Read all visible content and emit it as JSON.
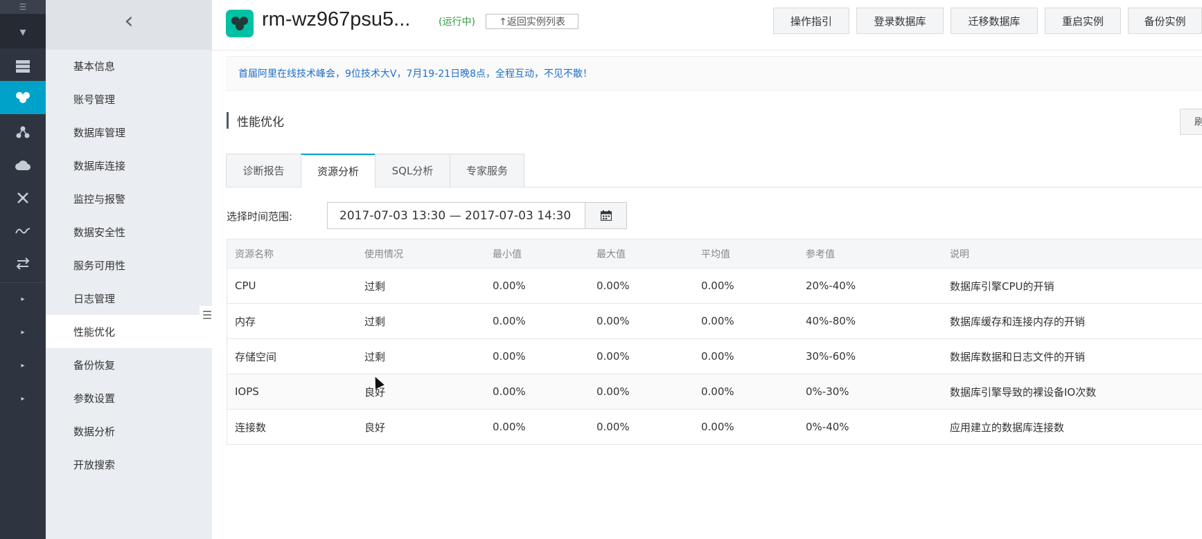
{
  "rail": {
    "icons": [
      "menu-icon",
      "caret-down-icon",
      "server-icon",
      "rds-icon",
      "cluster-icon",
      "cloud-icon",
      "network-icon",
      "wave-icon",
      "transfer-icon"
    ],
    "expand_arrows": [
      "▸",
      "▸",
      "▸",
      "▸"
    ],
    "accent": "#00a2ca"
  },
  "sidebar": {
    "collapse_glyph": "‹",
    "items": [
      {
        "label": "基本信息"
      },
      {
        "label": "账号管理"
      },
      {
        "label": "数据库管理"
      },
      {
        "label": "数据库连接"
      },
      {
        "label": "监控与报警"
      },
      {
        "label": "数据安全性"
      },
      {
        "label": "服务可用性"
      },
      {
        "label": "日志管理"
      },
      {
        "label": "性能优化",
        "active": true
      },
      {
        "label": "备份恢复"
      },
      {
        "label": "参数设置"
      },
      {
        "label": "数据分析"
      },
      {
        "label": "开放搜索"
      }
    ]
  },
  "header": {
    "instance_title": "rm-wz967psu5...",
    "status": "(运行中)",
    "back_label": "↑返回实例列表",
    "buttons": [
      "操作指引",
      "登录数据库",
      "迁移数据库",
      "重启实例",
      "备份实例"
    ]
  },
  "notice": {
    "text": "首届阿里在线技术峰会，9位技术大V，7月19-21日晚8点，全程互动，不见不散！",
    "color": "#1f6fc5"
  },
  "section": {
    "title": "性能优化",
    "refresh_label": "刷"
  },
  "tabs": [
    {
      "label": "诊断报告"
    },
    {
      "label": "资源分析",
      "active": true
    },
    {
      "label": "SQL分析"
    },
    {
      "label": "专家服务"
    }
  ],
  "time_range": {
    "label": "选择时间范围:",
    "value": "2017-07-03 13:30  —  2017-07-03 14:30",
    "calendar_icon": "calendar-icon"
  },
  "table": {
    "headers": [
      "资源名称",
      "使用情况",
      "最小值",
      "最大值",
      "平均值",
      "参考值",
      "说明"
    ],
    "rows": [
      [
        "CPU",
        "过剩",
        "0.00%",
        "0.00%",
        "0.00%",
        "20%-40%",
        "数据库引擎CPU的开销"
      ],
      [
        "内存",
        "过剩",
        "0.00%",
        "0.00%",
        "0.00%",
        "40%-80%",
        "数据库缓存和连接内存的开销"
      ],
      [
        "存储空间",
        "过剩",
        "0.00%",
        "0.00%",
        "0.00%",
        "30%-60%",
        "数据库数据和日志文件的开销"
      ],
      [
        "IOPS",
        "良好",
        "0.00%",
        "0.00%",
        "0.00%",
        "0%-30%",
        "数据库引擎导致的裸设备IO次数"
      ],
      [
        "连接数",
        "良好",
        "0.00%",
        "0.00%",
        "0.00%",
        "0%-40%",
        "应用建立的数据库连接数"
      ]
    ]
  }
}
